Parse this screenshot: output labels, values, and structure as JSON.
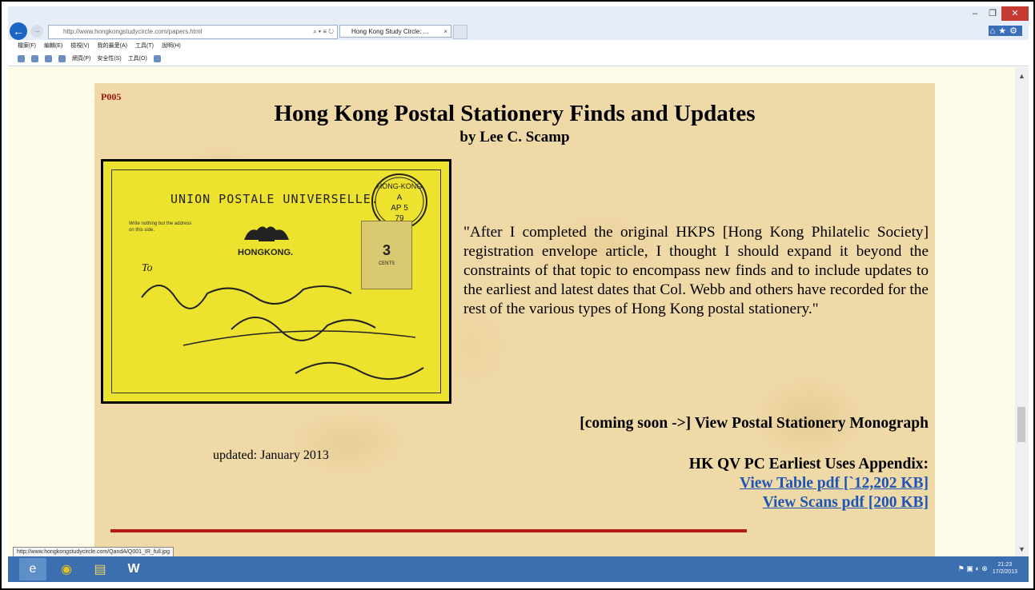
{
  "browser": {
    "url": "http://www.hongkongstudycircle.com/papers.html",
    "tab_title": "Hong Kong Study Circle: ...",
    "menu": [
      "檔案(F)",
      "編輯(E)",
      "檢視(V)",
      "我的最愛(A)",
      "工具(T)",
      "說明(H)"
    ],
    "command_bar": [
      "網頁(P)",
      "安全性(S)",
      "工具(O)"
    ],
    "status_url": "http://www.hongkongstudycircle.com/QandA/Q001_IR_full.jpg"
  },
  "page": {
    "code": "P005",
    "title": "Hong Kong Postal Stationery Finds and Updates",
    "byline": "by  Lee C. Scamp",
    "quote": "\"After I completed the original HKPS [Hong Kong Philatelic Society] registration envelope article, I thought I should expand it beyond the constraints of that topic to encompass new finds and to include  updates to the earliest and latest dates that Col. Webb and others have recorded for the rest of the various types of Hong Kong postal stationery.\"",
    "coming_soon": "[coming soon ->] View Postal Stationery Monograph",
    "updated": "updated: January 2013",
    "appendix_heading": "HK QV PC Earliest Uses Appendix:",
    "link_table": "View Table pdf [`12,202 KB]",
    "link_scans": "View Scans pdf [200 KB]"
  },
  "card": {
    "header": "UNION POSTALE UNIVERSELLE.",
    "note": "Write nothing but the address on this side.",
    "place": "HONGKONG.",
    "to": "To",
    "postmark_top": "HONG-KONG",
    "postmark_letter": "A",
    "postmark_date": "AP 5",
    "postmark_year": "79",
    "stamp_value": "3",
    "stamp_cents": "CENTS"
  },
  "taskbar": {
    "time": "21:23",
    "date": "17/2/2013"
  }
}
